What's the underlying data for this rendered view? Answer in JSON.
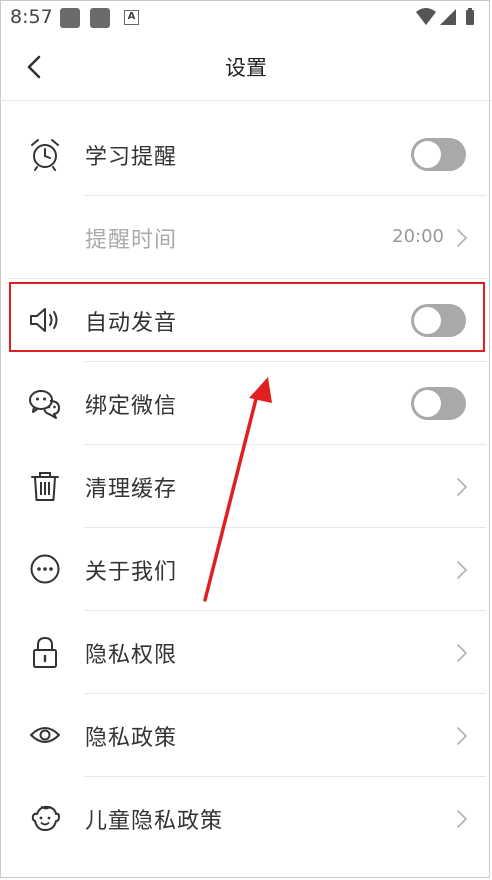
{
  "status_bar": {
    "time": "8:57",
    "a_glyph": "A"
  },
  "header": {
    "title": "设置",
    "back_icon": "chevron-left-icon"
  },
  "rows": [
    {
      "label": "学习提醒",
      "icon": "alarm-clock-icon",
      "control": "toggle",
      "on": false
    },
    {
      "label": "提醒时间",
      "value": "20:00",
      "control": "chevron",
      "disabled": true
    },
    {
      "label": "自动发音",
      "icon": "speaker-icon",
      "control": "toggle",
      "on": false,
      "highlighted": true
    },
    {
      "label": "绑定微信",
      "icon": "wechat-icon",
      "control": "toggle",
      "on": false
    },
    {
      "label": "清理缓存",
      "icon": "trash-icon",
      "control": "chevron"
    },
    {
      "label": "关于我们",
      "icon": "more-dots-icon",
      "control": "chevron"
    },
    {
      "label": "隐私权限",
      "icon": "lock-icon",
      "control": "chevron"
    },
    {
      "label": "隐私政策",
      "icon": "eye-icon",
      "control": "chevron"
    },
    {
      "label": "儿童隐私政策",
      "icon": "child-face-icon",
      "control": "chevron"
    }
  ],
  "colors": {
    "toggle_off": "#a9a9a9",
    "highlight_box": "#e02020",
    "divider": "#e6e6e6",
    "muted_text": "#aaaaaa"
  }
}
